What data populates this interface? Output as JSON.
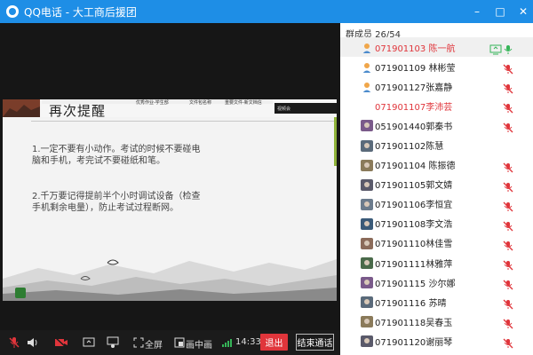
{
  "window": {
    "title": "QQ电话 - 大工商后援团",
    "min_label": "–",
    "max_label": "□",
    "close_label": "✕"
  },
  "slide": {
    "heading": "再次提醒",
    "band_labels": [
      "优秀作业-学生部",
      "文件包名称",
      "重要文件-新文档信"
    ],
    "popup_label": "视频会",
    "p1": "1.一定不要有小动作。考试的时候不要碰电脑和手机，考完试不要碰纸和笔。",
    "p2": "2.千万要记得提前半个小时调试设备（检查手机剩余电量），防止考试过程断网。"
  },
  "controls": {
    "fullscreen_label": "全屏",
    "pip_label": "画中画",
    "time": "14:33",
    "leave_label": "退出",
    "end_label": "结束通话"
  },
  "members": {
    "count_text": "群成员 26/54",
    "items": [
      {
        "name": "071901103 陈一航",
        "red": true,
        "speaker": true,
        "mic": "on",
        "avatar": "person"
      },
      {
        "name": "071901109 林彬莹",
        "red": false,
        "speaker": false,
        "mic": "off",
        "avatar": "person"
      },
      {
        "name": "071901127张嘉静",
        "red": false,
        "speaker": false,
        "mic": "off",
        "avatar": "person"
      },
      {
        "name": "071901107李沛芸",
        "red": true,
        "speaker": false,
        "mic": "off",
        "avatar": "blank"
      },
      {
        "name": "051901440郭秦书",
        "red": false,
        "speaker": false,
        "mic": "off",
        "avatar": "photo"
      },
      {
        "name": "071901102陈慧",
        "red": false,
        "speaker": false,
        "mic": "none",
        "avatar": "photo"
      },
      {
        "name": "071901104 陈振德",
        "red": false,
        "speaker": false,
        "mic": "off",
        "avatar": "photo"
      },
      {
        "name": "071901105郭文婧",
        "red": false,
        "speaker": false,
        "mic": "off",
        "avatar": "photo"
      },
      {
        "name": "071901106李恒宜",
        "red": false,
        "speaker": false,
        "mic": "off",
        "avatar": "photo"
      },
      {
        "name": "071901108李文浩",
        "red": false,
        "speaker": false,
        "mic": "off",
        "avatar": "photo"
      },
      {
        "name": "071901110林佳雪",
        "red": false,
        "speaker": false,
        "mic": "off",
        "avatar": "photo"
      },
      {
        "name": "071901111林雅萍",
        "red": false,
        "speaker": false,
        "mic": "off",
        "avatar": "photo"
      },
      {
        "name": "071901115 沙尔娜",
        "red": false,
        "speaker": false,
        "mic": "off",
        "avatar": "photo"
      },
      {
        "name": "071901116 苏晴",
        "red": false,
        "speaker": false,
        "mic": "off",
        "avatar": "photo"
      },
      {
        "name": "071901118吴春玉",
        "red": false,
        "speaker": false,
        "mic": "off",
        "avatar": "photo"
      },
      {
        "name": "071901120谢丽琴",
        "red": false,
        "speaker": false,
        "mic": "off",
        "avatar": "photo"
      }
    ]
  },
  "colors": {
    "titlebar": "#1e8ee6",
    "danger": "#e0353b",
    "speaker": "#35b558"
  }
}
